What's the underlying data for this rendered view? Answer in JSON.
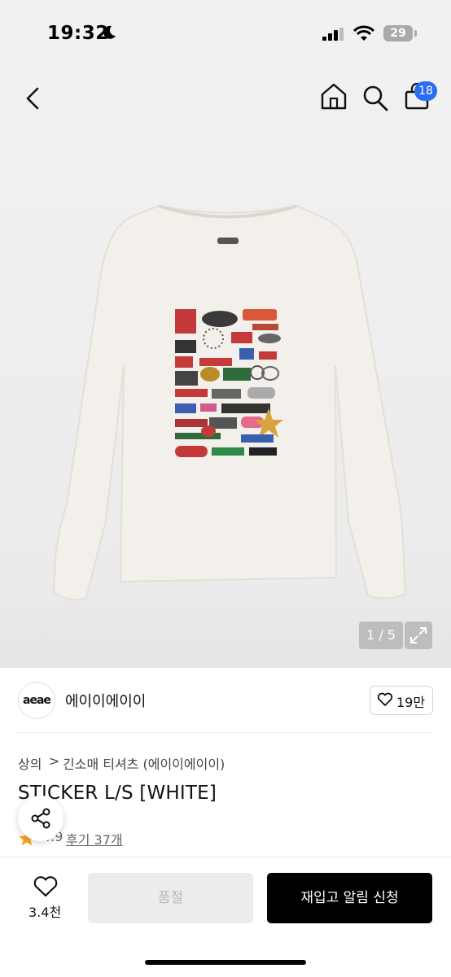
{
  "status_bar": {
    "time": "19:32",
    "battery": "29"
  },
  "nav": {
    "cart_count": "18"
  },
  "gallery": {
    "counter": "1 / 5"
  },
  "brand": {
    "logo_text": "aeae",
    "name": "에이이에이이",
    "likes": "19만"
  },
  "breadcrumb": {
    "category": "상의",
    "separator": ">",
    "subcategory": "긴소매 티셔츠 (에이이에이이)"
  },
  "product": {
    "title": "STICKER L/S [WHITE]",
    "rating": "4.9",
    "reviews": "후기 37개"
  },
  "bottom": {
    "wish_count": "3.4천",
    "soldout_label": "품절",
    "restock_label": "재입고 알림 신청"
  },
  "colors": {
    "accent_badge": "#2a6df4",
    "rating_star": "#f5a623"
  },
  "icons": [
    "moon-icon",
    "signal-icon",
    "wifi-icon",
    "back-icon",
    "home-icon",
    "search-icon",
    "cart-icon",
    "expand-icon",
    "heart-icon",
    "star-icon",
    "share-icon"
  ]
}
